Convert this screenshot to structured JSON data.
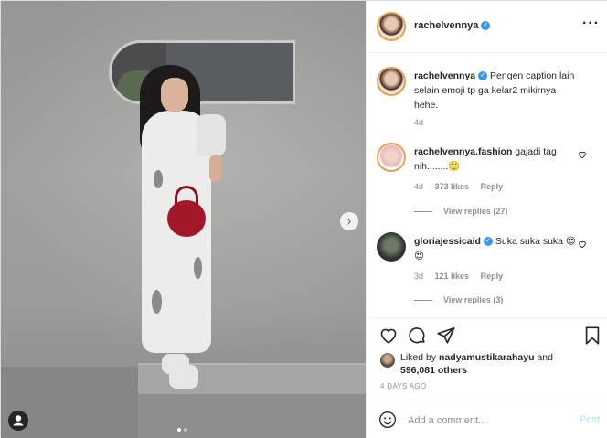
{
  "author": {
    "username": "rachelvennya",
    "verified": true
  },
  "header": {
    "more_icon": "more-dots-icon"
  },
  "caption": {
    "username": "rachelvennya",
    "text": "Pengen caption lain selain emoji tp ga kelar2 mikirnya hehe.",
    "time": "4d"
  },
  "comments": [
    {
      "username": "rachelvennya.fashion",
      "verified": false,
      "text": "gajadi tag nih........🙄",
      "time": "4d",
      "likes": "373 likes",
      "reply_label": "Reply",
      "view_replies": "View replies (27)"
    },
    {
      "username": "gloriajessicaid",
      "verified": true,
      "text": "Suka suka suka 😍😍",
      "time": "3d",
      "likes": "121 likes",
      "reply_label": "Reply",
      "view_replies": "View replies (3)"
    }
  ],
  "likes": {
    "prefix": "Liked by",
    "user": "nadyamustikarahayu",
    "and": "and",
    "count": "596,081 others"
  },
  "timestamp": "4 DAYS AGO",
  "add_comment": {
    "placeholder": "Add a comment...",
    "post_label": "Post"
  },
  "carousel": {
    "next_glyph": "›",
    "tag_glyph": "●",
    "slides": 2,
    "active_slide": 1
  },
  "colors": {
    "verified": "#3897f0",
    "post_disabled": "#b2dffc",
    "muted": "#8e8e8e"
  }
}
